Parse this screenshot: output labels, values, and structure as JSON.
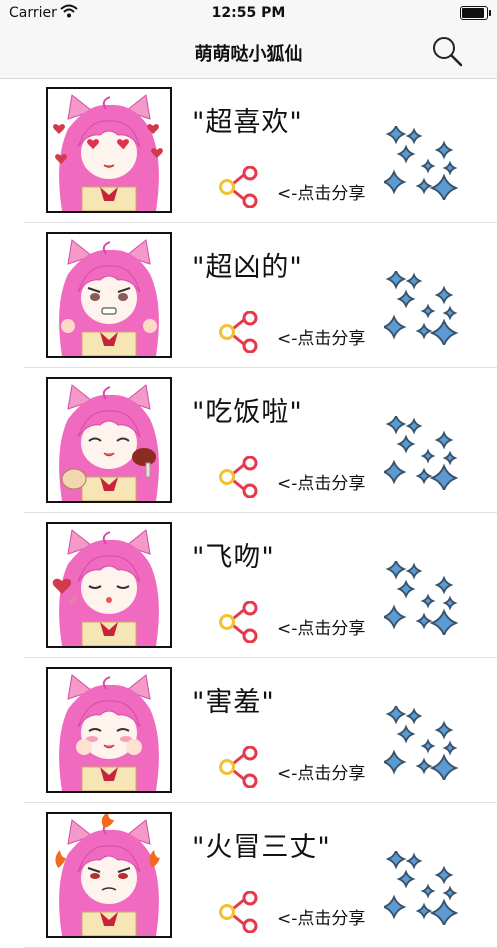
{
  "status_bar": {
    "carrier": "Carrier",
    "time": "12:55 PM"
  },
  "nav": {
    "title": "萌萌哒小狐仙",
    "search_icon": "search-icon"
  },
  "share_hint": "<-点击分享",
  "colors": {
    "hair": "#f06bbf",
    "hair_dark": "#d64aa6",
    "ear": "#f39ac9",
    "share_red": "#e8374a",
    "share_yellow": "#f2c22e",
    "sparkle": "#39526b"
  },
  "rows": [
    {
      "label": "\"超喜欢\"",
      "expression": "love"
    },
    {
      "label": "\"超凶的\"",
      "expression": "angry"
    },
    {
      "label": "\"吃饭啦\"",
      "expression": "eat"
    },
    {
      "label": "\"飞吻\"",
      "expression": "kiss"
    },
    {
      "label": "\"害羞\"",
      "expression": "shy"
    },
    {
      "label": "\"火冒三丈\"",
      "expression": "fire"
    }
  ]
}
